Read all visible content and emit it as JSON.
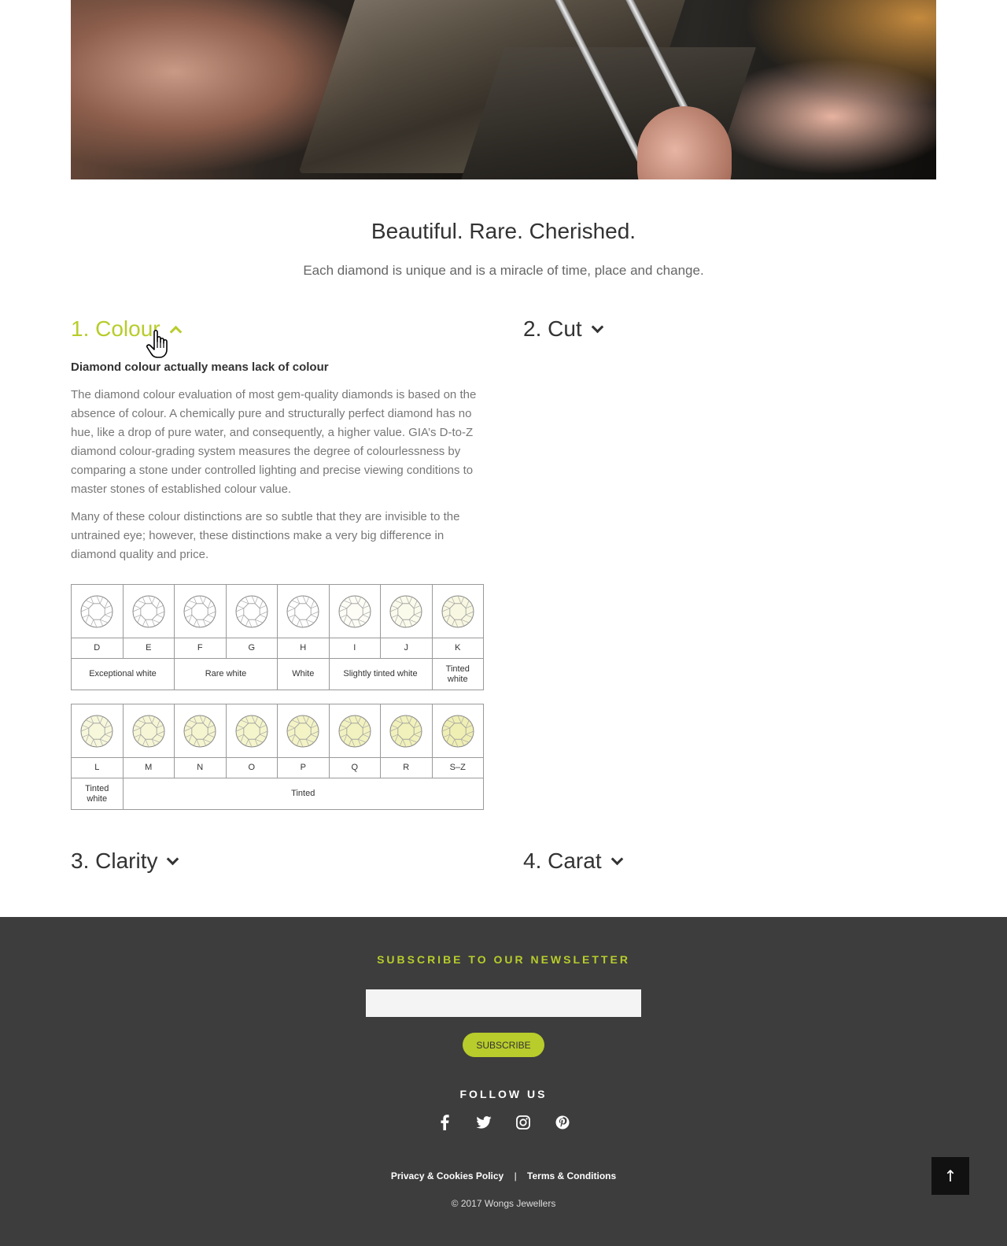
{
  "hero": {
    "image": "jeweller-working-stone-photo"
  },
  "intro": {
    "headline": "Beautiful. Rare. Cherished.",
    "subline": "Each diamond is unique and is a miracle of time, place and change."
  },
  "accordion": {
    "colour": {
      "label": "1. Colour",
      "expanded": true
    },
    "cut": {
      "label": "2. Cut",
      "expanded": false
    },
    "clarity": {
      "label": "3. Clarity",
      "expanded": false
    },
    "carat": {
      "label": "4. Carat",
      "expanded": false
    }
  },
  "colour_section": {
    "heading": "Diamond colour actually means lack of colour",
    "paragraph1": "The diamond colour evaluation of most gem-quality diamonds is based on the absence of colour. A chemically pure and structurally perfect diamond has no hue, like a drop of pure water, and consequently, a higher value. GIA’s D-to-Z diamond colour-grading system measures the degree of colourlessness by comparing a stone under controlled lighting and precise viewing conditions to master stones of established colour value.",
    "paragraph2": "Many of these colour distinctions are so subtle that they are invisible to the untrained eye; however, these distinctions make a very big difference in diamond quality and price.",
    "grade_table_1": {
      "letters": [
        "D",
        "E",
        "F",
        "G",
        "H",
        "I",
        "J",
        "K"
      ],
      "tints": [
        "#ffffff",
        "#ffffff",
        "#ffffff",
        "#ffffff",
        "#ffffff",
        "#fdfdf6",
        "#fbfbec",
        "#f8f8e2"
      ],
      "groups": [
        {
          "label": "Exceptional white",
          "span": 2
        },
        {
          "label": "Rare white",
          "span": 2
        },
        {
          "label": "White",
          "span": 1
        },
        {
          "label": "Slightly tinted white",
          "span": 2
        },
        {
          "label": "Tinted white",
          "span": 1
        }
      ]
    },
    "grade_table_2": {
      "letters": [
        "L",
        "M",
        "N",
        "O",
        "P",
        "Q",
        "R",
        "S–Z"
      ],
      "tints": [
        "#f7f7dc",
        "#f6f6d6",
        "#f5f5d0",
        "#f5f5cc",
        "#f3f3c6",
        "#f2f2c0",
        "#f1f1bb",
        "#efefb4"
      ],
      "groups": [
        {
          "label": "Tinted white",
          "span": 1
        },
        {
          "label": "Tinted",
          "span": 7
        }
      ]
    }
  },
  "footer": {
    "newsletter_title": "SUBSCRIBE TO OUR NEWSLETTER",
    "email_placeholder": "",
    "subscribe_label": "SUBSCRIBE",
    "follow_title": "FOLLOW US",
    "social_icons": [
      "facebook-icon",
      "twitter-icon",
      "instagram-icon",
      "pinterest-icon"
    ],
    "privacy_link": "Privacy & Cookies Policy",
    "separator": "|",
    "terms_link": "Terms & Conditions",
    "copyright": "© 2017 Wongs Jewellers",
    "back_to_top": "↑"
  },
  "colors": {
    "accent": "#b8cc2b",
    "footer_bg": "#3d3d3d",
    "text": "#333333"
  }
}
